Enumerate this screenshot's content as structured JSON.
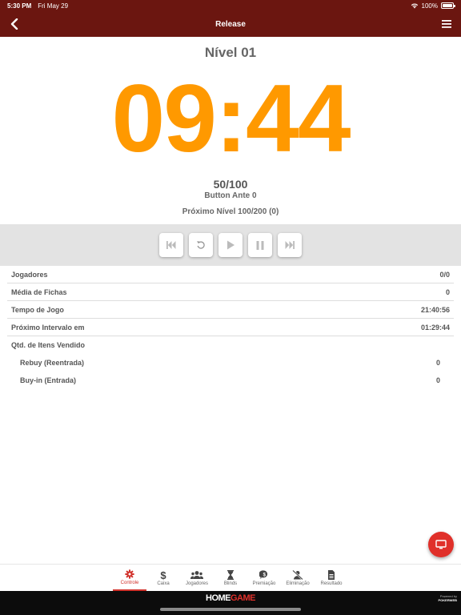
{
  "status_bar": {
    "time": "5:30 PM",
    "date": "Fri May 29",
    "battery": "100%",
    "battery_level": 1.0
  },
  "nav": {
    "title": "Release",
    "back_icon": "chevron-left-icon",
    "menu_icon": "hamburger-menu-icon"
  },
  "level": {
    "title": "Nível 01",
    "timer": "09:44",
    "blinds": "50/100",
    "ante": "Button Ante 0",
    "next_level": "Próximo Nível 100/200 (0)"
  },
  "colors": {
    "brand": "#6b1610",
    "timer": "#ff9900",
    "accent": "#d1322b",
    "fab": "#e0302a"
  },
  "controls": [
    {
      "name": "skip-back-icon",
      "action": "previous-level"
    },
    {
      "name": "restart-icon",
      "action": "restart"
    },
    {
      "name": "play-icon",
      "action": "play"
    },
    {
      "name": "pause-icon",
      "action": "pause"
    },
    {
      "name": "skip-forward-icon",
      "action": "next-level"
    }
  ],
  "stats": [
    {
      "label": "Jogadores",
      "value": "0/0"
    },
    {
      "label": "Média de Fichas",
      "value": "0"
    },
    {
      "label": "Tempo de Jogo",
      "value": "21:40:56"
    },
    {
      "label": "Próximo Intervalo em",
      "value": "01:29:44"
    },
    {
      "label": "Qtd. de Itens Vendido",
      "value": ""
    },
    {
      "label": "Rebuy (Reentrada)",
      "value": "0"
    },
    {
      "label": "Buy-in (Entrada)",
      "value": "0"
    }
  ],
  "tabs": [
    {
      "label": "Controle",
      "icon": "gear-icon",
      "active": true
    },
    {
      "label": "Caixa",
      "icon": "dollar-icon",
      "active": false
    },
    {
      "label": "Jogadores",
      "icon": "users-icon",
      "active": false
    },
    {
      "label": "Blinds",
      "icon": "hourglass-icon",
      "active": false
    },
    {
      "label": "Premiação",
      "icon": "prize-icon",
      "active": false
    },
    {
      "label": "Eliminação",
      "icon": "user-slash-icon",
      "active": false
    },
    {
      "label": "Resultado",
      "icon": "document-icon",
      "active": false
    }
  ],
  "brand": {
    "logo_text_1": "HOME",
    "logo_text_2": "GAME",
    "powered_by": "Powered by",
    "powered_brand": "POKERWEB"
  },
  "fab": {
    "icon": "monitor-icon"
  }
}
